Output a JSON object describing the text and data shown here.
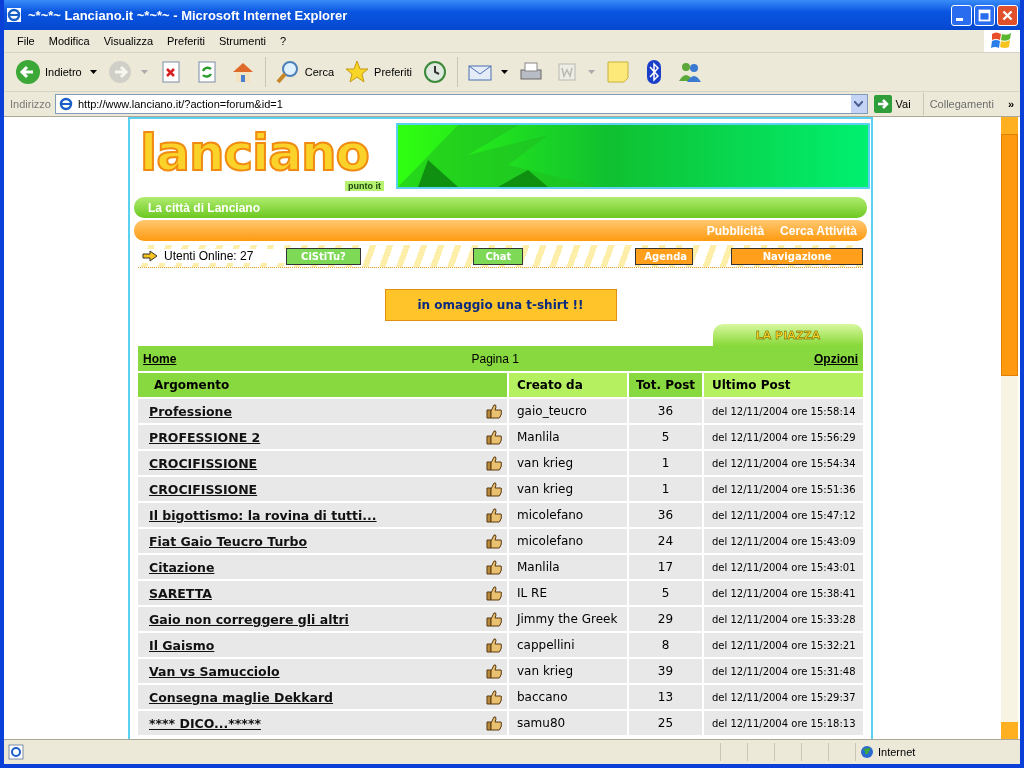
{
  "window": {
    "title": "~*~*~ Lanciano.it ~*~*~ - Microsoft Internet Explorer"
  },
  "menu_bar": [
    "File",
    "Modifica",
    "Visualizza",
    "Preferiti",
    "Strumenti",
    "?"
  ],
  "toolbar": [
    {
      "kind": "back",
      "label": "Indietro",
      "dropdown": true,
      "disabled": false
    },
    {
      "kind": "forward",
      "dropdown": true,
      "disabled": true
    },
    {
      "kind": "stop",
      "dropdown": false,
      "disabled": false
    },
    {
      "kind": "refresh",
      "dropdown": false,
      "disabled": false
    },
    {
      "kind": "home",
      "dropdown": false,
      "disabled": false
    },
    {
      "kind": "separator"
    },
    {
      "kind": "search",
      "label": "Cerca",
      "dropdown": false,
      "disabled": false
    },
    {
      "kind": "favorites",
      "label": "Preferiti",
      "dropdown": false,
      "disabled": false
    },
    {
      "kind": "history",
      "dropdown": false,
      "disabled": false
    },
    {
      "kind": "separator"
    },
    {
      "kind": "mail",
      "dropdown": true,
      "disabled": false
    },
    {
      "kind": "print",
      "dropdown": false,
      "disabled": false
    },
    {
      "kind": "edit",
      "dropdown": true,
      "disabled": true
    },
    {
      "kind": "note",
      "dropdown": false,
      "disabled": false
    },
    {
      "kind": "bluetooth",
      "dropdown": false,
      "disabled": false
    },
    {
      "kind": "messenger",
      "dropdown": false,
      "disabled": false
    }
  ],
  "address_bar": {
    "label": "Indirizzo",
    "url": "http://www.lanciano.it/?action=forum&id=1",
    "go": "Vai",
    "links": "Collegamenti",
    "more": "»"
  },
  "page": {
    "logo": {
      "name": "lanciano",
      "sub": "punto it"
    },
    "tagline": "La città di Lanciano",
    "top_links": [
      "Pubblicità",
      "Cerca Attività"
    ],
    "online": "Utenti Online: 27",
    "nav_buttons": [
      {
        "label": "CiStiTu?",
        "color": "#7ed957"
      },
      {
        "label": "Chat",
        "color": "#7ed957"
      },
      {
        "label": "Agenda",
        "color": "#ff9f1c"
      },
      {
        "label": "Navigazione",
        "color": "#ff9f1c"
      }
    ],
    "promo": "in omaggio una t-shirt !!",
    "section_tab": "LA PIAZZA",
    "forum": {
      "home": "Home",
      "page": "Pagina 1",
      "options": "Opzioni",
      "columns": [
        "Argomento",
        "Creato da",
        "Tot. Post",
        "Ultimo Post"
      ],
      "rows": [
        {
          "topic": "Professione",
          "author": "gaio_teucro",
          "posts": "36",
          "last_post": "del 12/11/2004 ore 15:58:14"
        },
        {
          "topic": "PROFESSIONE 2",
          "author": "Manlila",
          "posts": "5",
          "last_post": "del 12/11/2004 ore 15:56:29"
        },
        {
          "topic": "CROCIFISSIONE",
          "author": "van krieg",
          "posts": "1",
          "last_post": "del 12/11/2004 ore 15:54:34"
        },
        {
          "topic": "CROCIFISSIONE",
          "author": "van krieg",
          "posts": "1",
          "last_post": "del 12/11/2004 ore 15:51:36"
        },
        {
          "topic": "Il bigottismo: la rovina di tutti...",
          "author": "micolefano",
          "posts": "36",
          "last_post": "del 12/11/2004 ore 15:47:12"
        },
        {
          "topic": "Fiat Gaio Teucro Turbo",
          "author": "micolefano",
          "posts": "24",
          "last_post": "del 12/11/2004 ore 15:43:09"
        },
        {
          "topic": "Citazione",
          "author": "Manlila",
          "posts": "17",
          "last_post": "del 12/11/2004 ore 15:43:01"
        },
        {
          "topic": "SARETTA",
          "author": "IL RE",
          "posts": "5",
          "last_post": "del 12/11/2004 ore 15:38:41"
        },
        {
          "topic": "Gaio non correggere gli altri",
          "author": "Jimmy the Greek",
          "posts": "29",
          "last_post": "del 12/11/2004 ore 15:33:28"
        },
        {
          "topic": "Il Gaismo",
          "author": "cappellini",
          "posts": "8",
          "last_post": "del 12/11/2004 ore 15:32:21"
        },
        {
          "topic": "Van vs Samucciolo",
          "author": "van krieg",
          "posts": "39",
          "last_post": "del 12/11/2004 ore 15:31:48"
        },
        {
          "topic": "Consegna maglie Dekkard",
          "author": "baccano",
          "posts": "13",
          "last_post": "del 12/11/2004 ore 15:29:37"
        },
        {
          "topic": "**** DICO...*****",
          "author": "samu80",
          "posts": "25",
          "last_post": "del 12/11/2004 ore 15:18:13"
        }
      ]
    }
  },
  "status_bar": {
    "zone": "Internet"
  }
}
